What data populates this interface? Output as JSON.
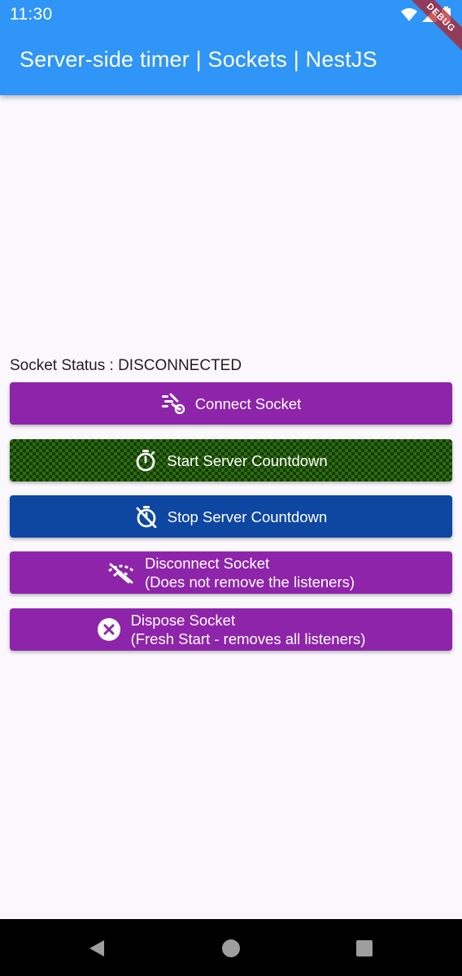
{
  "status_bar": {
    "time": "11:30",
    "icons": [
      "wifi-icon",
      "signal-icon",
      "battery-icon"
    ]
  },
  "app_bar": {
    "title": "Server-side timer | Sockets | NestJS",
    "color": "#2f95f7"
  },
  "debug_banner": "DEBUG",
  "socket_status": {
    "text": "Socket Status : DISCONNECTED"
  },
  "buttons": {
    "connect": {
      "label": "Connect Socket",
      "icon": "connect-socket-icon",
      "color": "#8e24aa"
    },
    "start": {
      "label": "Start Server Countdown",
      "icon": "timer-icon",
      "color": "#2e6b12"
    },
    "stop": {
      "label": "Stop Server Countdown",
      "icon": "timer-off-icon",
      "color": "#0d47a1"
    },
    "disconnect": {
      "line1": "Disconnect Socket",
      "line2": "(Does not remove the listeners)",
      "icon": "wifi-off-icon",
      "color": "#8e24aa"
    },
    "dispose": {
      "line1": "Dispose Socket",
      "line2": "(Fresh Start - removes all listeners)",
      "icon": "cancel-icon",
      "color": "#8e24aa"
    }
  },
  "nav_bar": {
    "items": [
      "back-icon",
      "home-icon",
      "recents-icon"
    ]
  }
}
